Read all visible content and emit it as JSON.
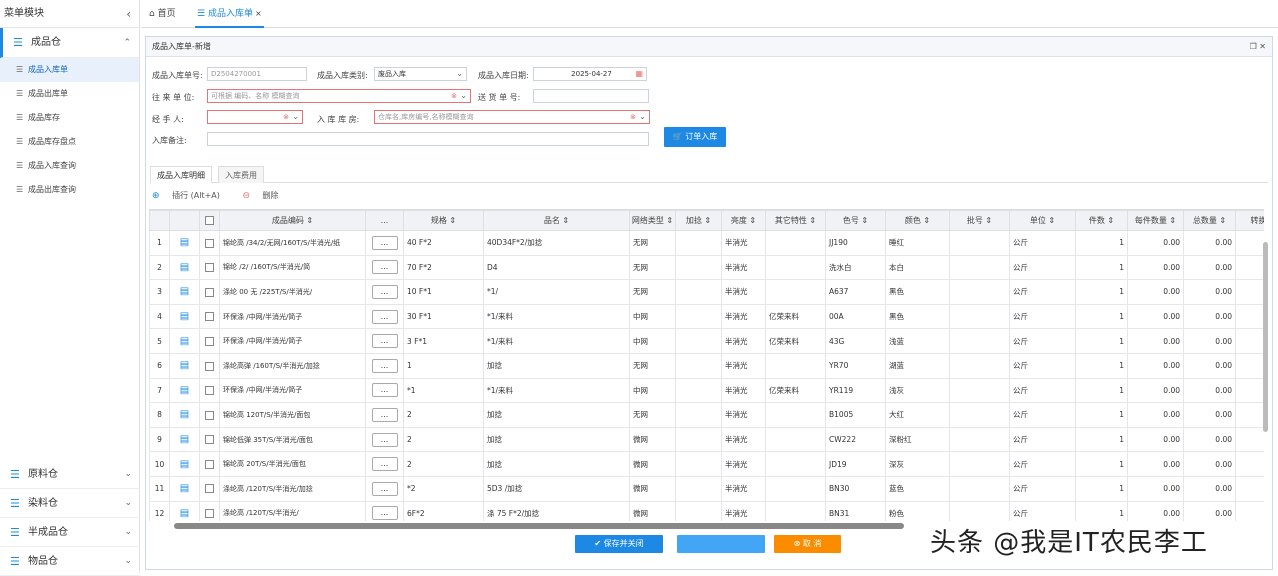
{
  "sidebar": {
    "title": "菜单模块",
    "groups_top": [
      {
        "label": "成品仓"
      }
    ],
    "items": [
      {
        "label": "成品入库单"
      },
      {
        "label": "成品出库单"
      },
      {
        "label": "成品库存"
      },
      {
        "label": "成品库存盘点"
      },
      {
        "label": "成品入库查询"
      },
      {
        "label": "成品出库查询"
      }
    ],
    "groups_bottom": [
      {
        "label": "原料仓"
      },
      {
        "label": "染料仓"
      },
      {
        "label": "半成品仓"
      },
      {
        "label": "物品仓"
      }
    ]
  },
  "tabs": [
    {
      "label": "首页"
    },
    {
      "label": "成品入库单"
    }
  ],
  "panel": {
    "title": "成品入库单-新增",
    "form": {
      "order_no_label": "成品入库单号:",
      "order_no_value": "D2504270001",
      "type_label": "成品入库类别:",
      "type_value": "废品入库",
      "date_label": "成品入库日期:",
      "date_value": "2025-04-27",
      "partner_label": "往 来 单 位:",
      "partner_placeholder": "可根据 编码、名称 模糊查询",
      "delivery_label": "送 货 单 号:",
      "handler_label": "经 手 人:",
      "warehouse_label": "入 库 库 房:",
      "warehouse_placeholder": "仓库名,库房编号,名称模糊查询",
      "remark_label": "入库备注:",
      "order_button": "订单入库"
    },
    "detail_tabs": [
      {
        "label": "成品入库明细"
      },
      {
        "label": "入库费用"
      }
    ],
    "tools": {
      "add": "插行 (Alt+A)",
      "delete": "删除"
    },
    "columns": [
      "成品编码",
      "...",
      "规格",
      "品名",
      "网络类型",
      "加捻",
      "亮度",
      "其它特性",
      "色号",
      "颜色",
      "批号",
      "单位",
      "件数",
      "每件数量",
      "总数量",
      "转换率"
    ],
    "rows": [
      {
        "n": "1",
        "code": "锦纶高 /34/2/无网/160T/S/半消光/纸 ",
        "spec": "40 F*2",
        "name": " 40D34F*2/加捻",
        "net": "无网",
        "bright": "半消光",
        "other": "",
        "color_no": "JJ190",
        "color": "睡红",
        "unit": "公斤",
        "pcs": "1",
        "per": "0.00",
        "total": "0.00"
      },
      {
        "n": "2",
        "code": "锦纶 /2/ /160T/S/半消光/简 ",
        "spec": "70 F*2",
        "name": " D4 ",
        "net": "无网",
        "bright": "半消光",
        "other": "",
        "color_no": "洗水白",
        "color": "本白",
        "unit": "公斤",
        "pcs": "1",
        "per": "0.00",
        "total": "0.00"
      },
      {
        "n": "3",
        "code": "涤纶 00 无 /225T/S/半消光/ ",
        "spec": "10 F*1",
        "name": " *1/ ",
        "net": "无网",
        "bright": "半消光",
        "other": "",
        "color_no": "A637",
        "color": "黑色",
        "unit": "公斤",
        "pcs": "1",
        "per": "0.00",
        "total": "0.00"
      },
      {
        "n": "4",
        "code": "环保涤 /中网/半消光/简子 ",
        "spec": "30 F*1",
        "name": " *1/来料",
        "net": "中网",
        "bright": "半消光",
        "other": "亿荣来料",
        "color_no": "00A",
        "color": "黑色",
        "unit": "公斤",
        "pcs": "1",
        "per": "0.00",
        "total": "0.00"
      },
      {
        "n": "5",
        "code": "环保涤 /中网/半消光/简子 ",
        "spec": "3 F*1",
        "name": " *1/来料",
        "net": "中网",
        "bright": "半消光",
        "other": "亿荣来料",
        "color_no": "43G",
        "color": "浅蓝",
        "unit": "公斤",
        "pcs": "1",
        "per": "0.00",
        "total": "0.00"
      },
      {
        "n": "6",
        "code": "涤纶高弹 /160T/S/半消光/加捻 ",
        "spec": " 1",
        "name": " 加捻",
        "net": "无网",
        "bright": "半消光",
        "other": "",
        "color_no": "YR70",
        "color": "湖蓝",
        "unit": "公斤",
        "pcs": "1",
        "per": "0.00",
        "total": "0.00"
      },
      {
        "n": "7",
        "code": "环保涤 /中网/半消光/简子 ",
        "spec": " *1",
        "name": " *1/来料",
        "net": "中网",
        "bright": "半消光",
        "other": "亿荣来料",
        "color_no": "YR119",
        "color": "浅灰",
        "unit": "公斤",
        "pcs": "1",
        "per": "0.00",
        "total": "0.00"
      },
      {
        "n": "8",
        "code": "锦纶高 120T/S/半消光/面包 ",
        "spec": " 2",
        "name": " 加捻",
        "net": "无网",
        "bright": "半消光",
        "other": "",
        "color_no": "B1005",
        "color": "大红",
        "unit": "公斤",
        "pcs": "1",
        "per": "0.00",
        "total": "0.00"
      },
      {
        "n": "9",
        "code": "锦纶低弹 35T/S/半消光/面包 ",
        "spec": " 2",
        "name": " 加捻",
        "net": "微网",
        "bright": "半消光",
        "other": "",
        "color_no": "CW222",
        "color": "深粉红",
        "unit": "公斤",
        "pcs": "1",
        "per": "0.00",
        "total": "0.00"
      },
      {
        "n": "10",
        "code": "锦纶高 20T/S/半消光/面包 ",
        "spec": " 2",
        "name": " 加捻",
        "net": "微网",
        "bright": "半消光",
        "other": "",
        "color_no": "JD19",
        "color": "深灰",
        "unit": "公斤",
        "pcs": "1",
        "per": "0.00",
        "total": "0.00"
      },
      {
        "n": "11",
        "code": "涤纶高 /120T/S/半消光/加捻 ",
        "spec": " *2",
        "name": " 5D3 /加捻",
        "net": "微网",
        "bright": "半消光",
        "other": "",
        "color_no": "BN30",
        "color": "蓝色",
        "unit": "公斤",
        "pcs": "1",
        "per": "0.00",
        "total": "0.00"
      },
      {
        "n": "12",
        "code": "涤纶高 /120T/S/半消光/ ",
        "spec": " 6F*2",
        "name": "涤 75 F*2/加捻",
        "net": "微网",
        "bright": "半消光",
        "other": "",
        "color_no": "BN31",
        "color": "粉色",
        "unit": "公斤",
        "pcs": "1",
        "per": "0.00",
        "total": "0.00"
      }
    ],
    "buttons": {
      "save_close": "保存并关闭",
      "save_new": "",
      "cancel": "取 消"
    }
  },
  "watermark": "头条 @我是IT农民李工"
}
